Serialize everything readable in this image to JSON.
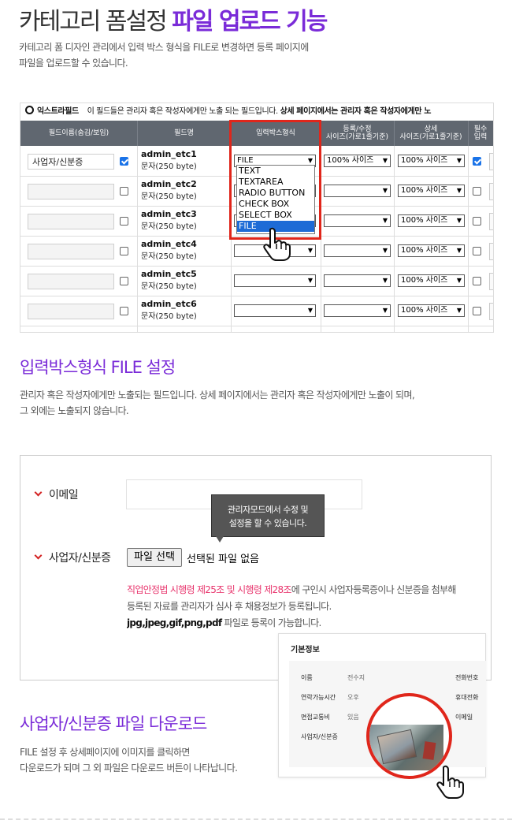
{
  "section1": {
    "title_plain": "카테고리 폼설정",
    "title_highlight": "파일 업로드 기능",
    "desc_line1": "카테고리 폼 디자인 관리에서 입력 박스 형식을 FILE로 변경하면 등록 페이지에",
    "desc_line2": "파일을 업로드할 수 있습니다."
  },
  "field_table": {
    "extra_label": "익스트라필드",
    "notice_plain": "이 필드들은 관리자 혹은 작성자에게만 노출 되는 필드입니다.",
    "notice_bold": "상세 페이지에서는 관리자 혹은 작성자에게만 노",
    "headers": {
      "field_name": "필드이름(숨김/보임)",
      "field_id": "필드명",
      "input_type": "입력박스형식",
      "reg_size_1": "등록/수정",
      "reg_size_2": "사이즈(가로1줄기준)",
      "detail_size_1": "상세",
      "detail_size_2": "사이즈(가로1줄기준)",
      "required_1": "필수",
      "required_2": "입력"
    },
    "rows": [
      {
        "label": "사업자/신분증",
        "field": "admin_etc1",
        "type": "문자(250 byte)",
        "input_type": "FILE",
        "reg_size": "100% 사이즈",
        "detail_size": "100% 사이즈"
      },
      {
        "label": "",
        "field": "admin_etc2",
        "type": "문자(250 byte)",
        "input_type": "",
        "reg_size": "",
        "detail_size": "100% 사이즈"
      },
      {
        "label": "",
        "field": "admin_etc3",
        "type": "문자(250 byte)",
        "input_type": "",
        "reg_size": "",
        "detail_size": "100% 사이즈"
      },
      {
        "label": "",
        "field": "admin_etc4",
        "type": "문자(250 byte)",
        "input_type": "",
        "reg_size": "",
        "detail_size": "100% 사이즈"
      },
      {
        "label": "",
        "field": "admin_etc5",
        "type": "문자(250 byte)",
        "input_type": "",
        "reg_size": "",
        "detail_size": "100% 사이즈"
      },
      {
        "label": "",
        "field": "admin_etc6",
        "type": "문자(250 byte)",
        "input_type": "",
        "reg_size": "",
        "detail_size": "100% 사이즈"
      }
    ],
    "dropdown_options": [
      "TEXT",
      "TEXTAREA",
      "RADIO BUTTON",
      "CHECK BOX",
      "SELECT BOX",
      "FILE"
    ],
    "dropdown_selected": "FILE"
  },
  "section2": {
    "title": "입력박스형식 FILE 설정",
    "desc_line1": "관리자 혹은 작성자에게만 노출되는 필드입니다. 상세 페이지에서는 관리자 혹은 작성자에게만 노출이 되며,",
    "desc_line2": "그 외에는 노출되지 않습니다."
  },
  "form": {
    "email_label": "이메일",
    "tooltip_line1": "관리자모드에서 수정 및",
    "tooltip_line2": "설정을 할 수 있습니다.",
    "business_label": "사업자/신분증",
    "file_button": "파일 선택",
    "file_status": "선택된 파일 없음",
    "notice_red1": "직업안정법 시행령 제25조",
    "notice_and": " 및 ",
    "notice_red2": "시행령 제28조",
    "notice_rest": "에 구인시 사업자등록증이나 신분증을 첨부해",
    "notice_line2": "등록된 자료를 관리자가 심사 후 채용정보가 등록됩니다.",
    "notice_formats": "jpg,jpeg,gif,png,pdf",
    "notice_line3_rest": " 파일로 등록이 가능합니다."
  },
  "detail_card": {
    "title": "기본정보",
    "name_label": "이름",
    "name_value": "전수지",
    "phone_label": "전화번호",
    "contact_time_label": "연락가능시간",
    "contact_time_value": "오후",
    "mobile_label": "휴대전화",
    "transport_label": "면접교통비",
    "transport_value": "있음",
    "email_label": "이메일",
    "id_label": "사업자/신분증"
  },
  "section3": {
    "title": "사업자/신분증 파일 다운로드",
    "desc_line1": "FILE 설정 후 상세페이지에 이미지를 클릭하면",
    "desc_line2": "다운로드가 되며 그 외 파일은 다운로드 버튼이 나타납니다."
  },
  "colors": {
    "accent": "#7a2bd8",
    "highlight_red": "#e0261b",
    "notice_red": "#e8356d",
    "header_gray": "#606770"
  }
}
